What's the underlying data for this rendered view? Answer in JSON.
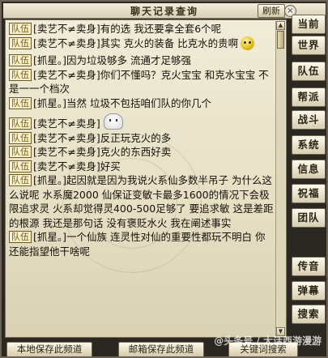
{
  "window": {
    "title": "聊天记录查询",
    "refresh_label": "刷新",
    "close_label": "×"
  },
  "messages": [
    {
      "channel": "队伍",
      "text": "[卖艺不≠卖身]有的选 我还要拿全套6个呢"
    },
    {
      "channel": "队伍",
      "text": "[卖艺不≠卖身]其实 克火的装备 比克水的贵啊"
    },
    {
      "channel": "队伍",
      "text": "[抓星。]因为垃圾够多 流通才足够强"
    },
    {
      "channel": "队伍",
      "text": "[卖艺不≠卖身]你们不懂吗？克火宝宝 和克水宝宝 不是一一个档次"
    },
    {
      "channel": "队伍",
      "text": "[抓星。]当然 垃圾不包括咱们队的你几个"
    },
    {
      "channel": "队伍",
      "text": "[卖艺不≠卖身]"
    },
    {
      "channel": "队伍",
      "text": "[卖艺不≠卖身]反正玩克火的多"
    },
    {
      "channel": "队伍",
      "text": "[卖艺不≠卖身]克火的东西好卖"
    },
    {
      "channel": "队伍",
      "text": "[卖艺不≠卖身]好买"
    },
    {
      "channel": "队伍",
      "text": "[抓星。]起因就是因为我说火系仙多数半吊子 为什么这么说呢 水系魔2000 仙保证变敏卡最多1600的情况下会极限追求灵 火系却觉得灵400-500足够了 要追求敏 这是差距的根源 我还是那句话 没有褒贬水火 我在阐述事实"
    },
    {
      "channel": "队伍",
      "text": "[抓星。]一个仙族 连灵性对仙的重要性都玩不明白 你还能指望他干啥呢"
    }
  ],
  "channels": [
    "当前",
    "世界",
    "队伍",
    "帮派",
    "战斗",
    "系统",
    "信息",
    "祝福",
    "团队",
    "传音",
    "弹幕",
    "搜索"
  ],
  "bottom_buttons": {
    "save_local": "本地保存此频道",
    "save_mail": "邮箱保存此频道",
    "keyword_search": "关键词搜索"
  },
  "watermark": "@头条号 / 大话西游漫游"
}
